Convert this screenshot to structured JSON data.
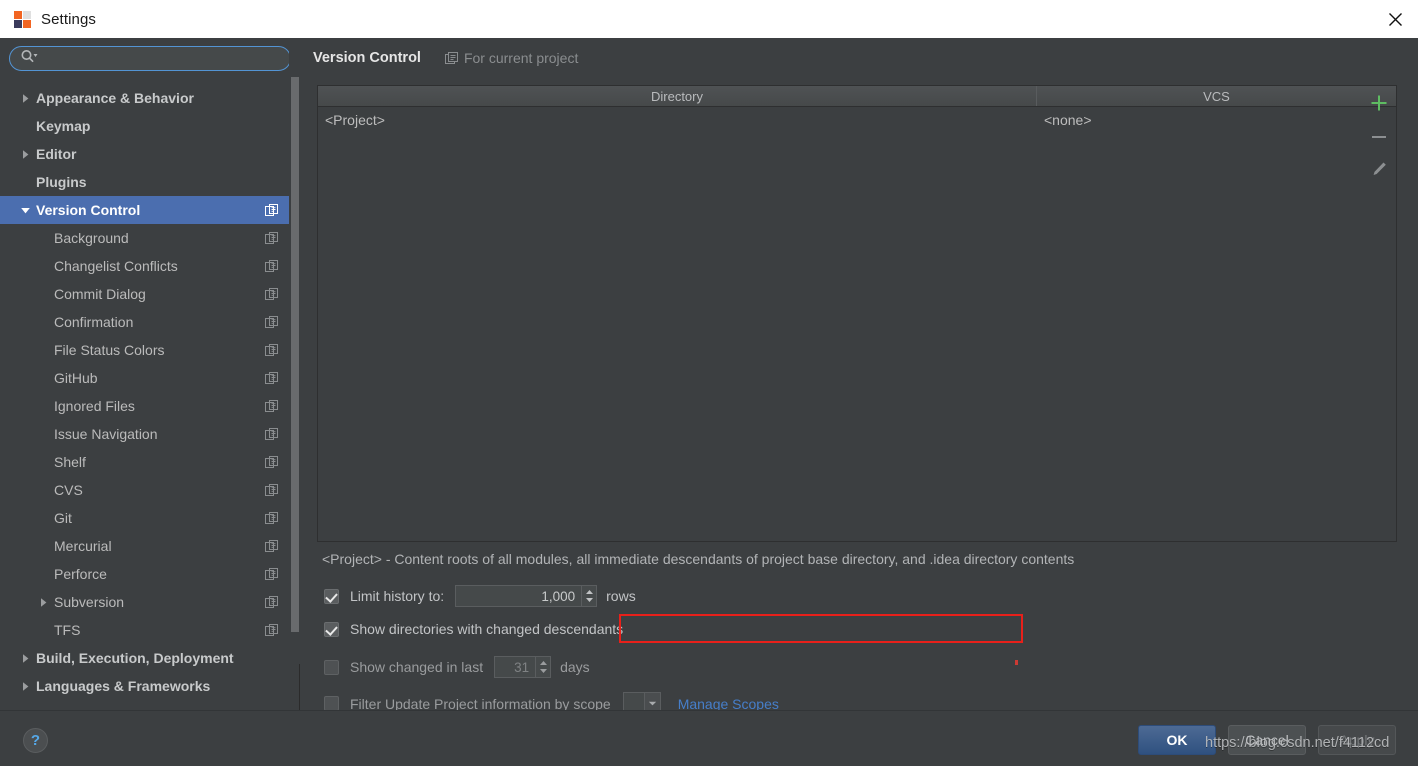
{
  "window": {
    "title": "Settings",
    "app_icon": "intellij-idea-icon",
    "close_icon": "close-icon"
  },
  "search": {
    "icon": "search-icon",
    "value": "",
    "placeholder": ""
  },
  "sidebar": {
    "items": [
      {
        "label": "Appearance & Behavior",
        "level": "top",
        "arrow": "collapsed",
        "project_icon": false,
        "selected": false
      },
      {
        "label": "Keymap",
        "level": "top",
        "arrow": "none",
        "project_icon": false,
        "selected": false
      },
      {
        "label": "Editor",
        "level": "top",
        "arrow": "collapsed",
        "project_icon": false,
        "selected": false
      },
      {
        "label": "Plugins",
        "level": "top",
        "arrow": "none",
        "project_icon": false,
        "selected": false
      },
      {
        "label": "Version Control",
        "level": "top",
        "arrow": "expanded",
        "project_icon": true,
        "selected": true
      },
      {
        "label": "Background",
        "level": "child",
        "arrow": "none",
        "project_icon": true,
        "selected": false
      },
      {
        "label": "Changelist Conflicts",
        "level": "child",
        "arrow": "none",
        "project_icon": true,
        "selected": false
      },
      {
        "label": "Commit Dialog",
        "level": "child",
        "arrow": "none",
        "project_icon": true,
        "selected": false
      },
      {
        "label": "Confirmation",
        "level": "child",
        "arrow": "none",
        "project_icon": true,
        "selected": false
      },
      {
        "label": "File Status Colors",
        "level": "child",
        "arrow": "none",
        "project_icon": true,
        "selected": false
      },
      {
        "label": "GitHub",
        "level": "child",
        "arrow": "none",
        "project_icon": true,
        "selected": false
      },
      {
        "label": "Ignored Files",
        "level": "child",
        "arrow": "none",
        "project_icon": true,
        "selected": false
      },
      {
        "label": "Issue Navigation",
        "level": "child",
        "arrow": "none",
        "project_icon": true,
        "selected": false
      },
      {
        "label": "Shelf",
        "level": "child",
        "arrow": "none",
        "project_icon": true,
        "selected": false
      },
      {
        "label": "CVS",
        "level": "child",
        "arrow": "none",
        "project_icon": true,
        "selected": false
      },
      {
        "label": "Git",
        "level": "child",
        "arrow": "none",
        "project_icon": true,
        "selected": false
      },
      {
        "label": "Mercurial",
        "level": "child",
        "arrow": "none",
        "project_icon": true,
        "selected": false
      },
      {
        "label": "Perforce",
        "level": "child",
        "arrow": "none",
        "project_icon": true,
        "selected": false
      },
      {
        "label": "Subversion",
        "level": "child",
        "arrow": "collapsed",
        "project_icon": true,
        "selected": false
      },
      {
        "label": "TFS",
        "level": "child",
        "arrow": "none",
        "project_icon": true,
        "selected": false
      },
      {
        "label": "Build, Execution, Deployment",
        "level": "top",
        "arrow": "collapsed",
        "project_icon": false,
        "selected": false
      },
      {
        "label": "Languages & Frameworks",
        "level": "top",
        "arrow": "collapsed",
        "project_icon": false,
        "selected": false
      }
    ]
  },
  "main": {
    "title": "Version Control",
    "subtitle": "For current project",
    "subtitle_icon": "for-current-project-icon",
    "table": {
      "columns": [
        "Directory",
        "VCS"
      ],
      "rows": [
        {
          "directory": "<Project>",
          "vcs": "<none>"
        }
      ]
    },
    "toolbar": {
      "add_icon": "plus-icon",
      "remove_icon": "minus-icon",
      "edit_icon": "pencil-icon"
    },
    "description": "<Project> - Content roots of all modules, all immediate descendants of project base directory, and .idea directory contents",
    "options": {
      "limit_history": {
        "label": "Limit history to:",
        "checked": true,
        "value": "1,000",
        "unit": "rows"
      },
      "show_directories": {
        "label": "Show directories with changed descendants",
        "checked": true,
        "highlighted": true
      },
      "show_changed_in_last": {
        "label": "Show changed in last",
        "checked": false,
        "value": "31",
        "unit": "days"
      },
      "filter_by_scope": {
        "label": "Filter Update Project information by scope",
        "checked": false,
        "scope_value": "",
        "manage_link": "Manage Scopes"
      }
    }
  },
  "footer": {
    "help_label": "?",
    "ok_label": "OK",
    "cancel_label": "Cancel",
    "apply_label": "Apply"
  },
  "watermark": "https://blog.csdn.net/f4112cd",
  "colors": {
    "window_bg": "#3c3f41",
    "selection_blue": "#4b6eaf",
    "accent_link": "#467ec9",
    "annotation_red": "#e8201a",
    "add_green": "#5ebd62",
    "title_bar": "#ffffff"
  }
}
